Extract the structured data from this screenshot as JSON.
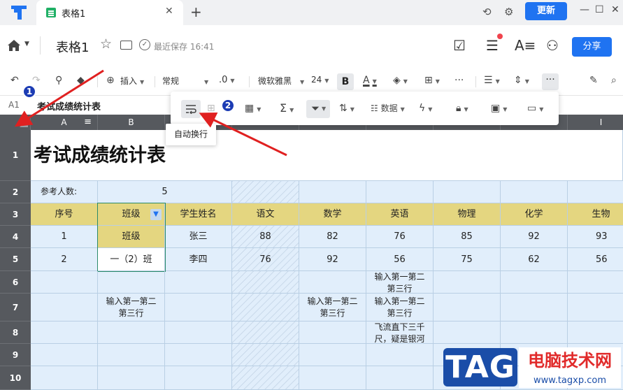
{
  "tabbar": {
    "tab_title": "表格1",
    "tab_close": "✕",
    "new_tab": "+",
    "update_label": "更新",
    "win_min": "—",
    "win_max": "☐",
    "win_close": "✕"
  },
  "header": {
    "doc_title": "表格1",
    "saved_text": "最近保存 16:41",
    "share_label": "分享"
  },
  "toolbar": {
    "insert_label": "插入",
    "format_label": "常规",
    "decimal_label": ".0",
    "font_name": "微软雅黑",
    "font_size": "24",
    "bold_label": "B",
    "font_color_label": "A",
    "more_label": "···"
  },
  "formula_bar": {
    "cell_ref": "A1",
    "content": "考试成绩统计表"
  },
  "popup": {
    "sigma_label": "Σ",
    "data_label": "数据",
    "tooltip": "自动换行"
  },
  "annotations": {
    "badge1": "1",
    "badge2": "2"
  },
  "sheet": {
    "columns": [
      "A",
      "B",
      "C",
      "D",
      "E",
      "F",
      "G",
      "H",
      "I"
    ],
    "rows": [
      "1",
      "2",
      "3",
      "4",
      "5",
      "6",
      "7",
      "8",
      "9",
      "10"
    ],
    "title": "考试成绩统计表",
    "participants_label": "参考人数:",
    "participants_value": "5",
    "headers": [
      "序号",
      "班级",
      "学生姓名",
      "语文",
      "数学",
      "英语",
      "物理",
      "化学",
      "生物"
    ],
    "row4": [
      "1",
      "班级",
      "张三",
      "88",
      "82",
      "76",
      "85",
      "92",
      "93"
    ],
    "row5": [
      "2",
      "一（2）班",
      "李四",
      "76",
      "92",
      "56",
      "75",
      "62",
      "56"
    ],
    "r6_f": "输入第一第二第三行",
    "r7_b": "输入第一第二第三行",
    "r7_e": "输入第一第二第三行",
    "r7_f": "输入第一第二第三行",
    "r8_f": "飞流直下三千尺，疑是银河"
  },
  "watermark": {
    "tag": "TAG",
    "cn": "电脑技术网",
    "url": "www.tagxp.com"
  },
  "colors": {
    "accent": "#1f73f1",
    "header_fill": "#e4d680",
    "cell_fill": "#e1eefb",
    "grid_header": "#56595e",
    "arrow": "#e02020",
    "badge": "#1c3cb4"
  }
}
